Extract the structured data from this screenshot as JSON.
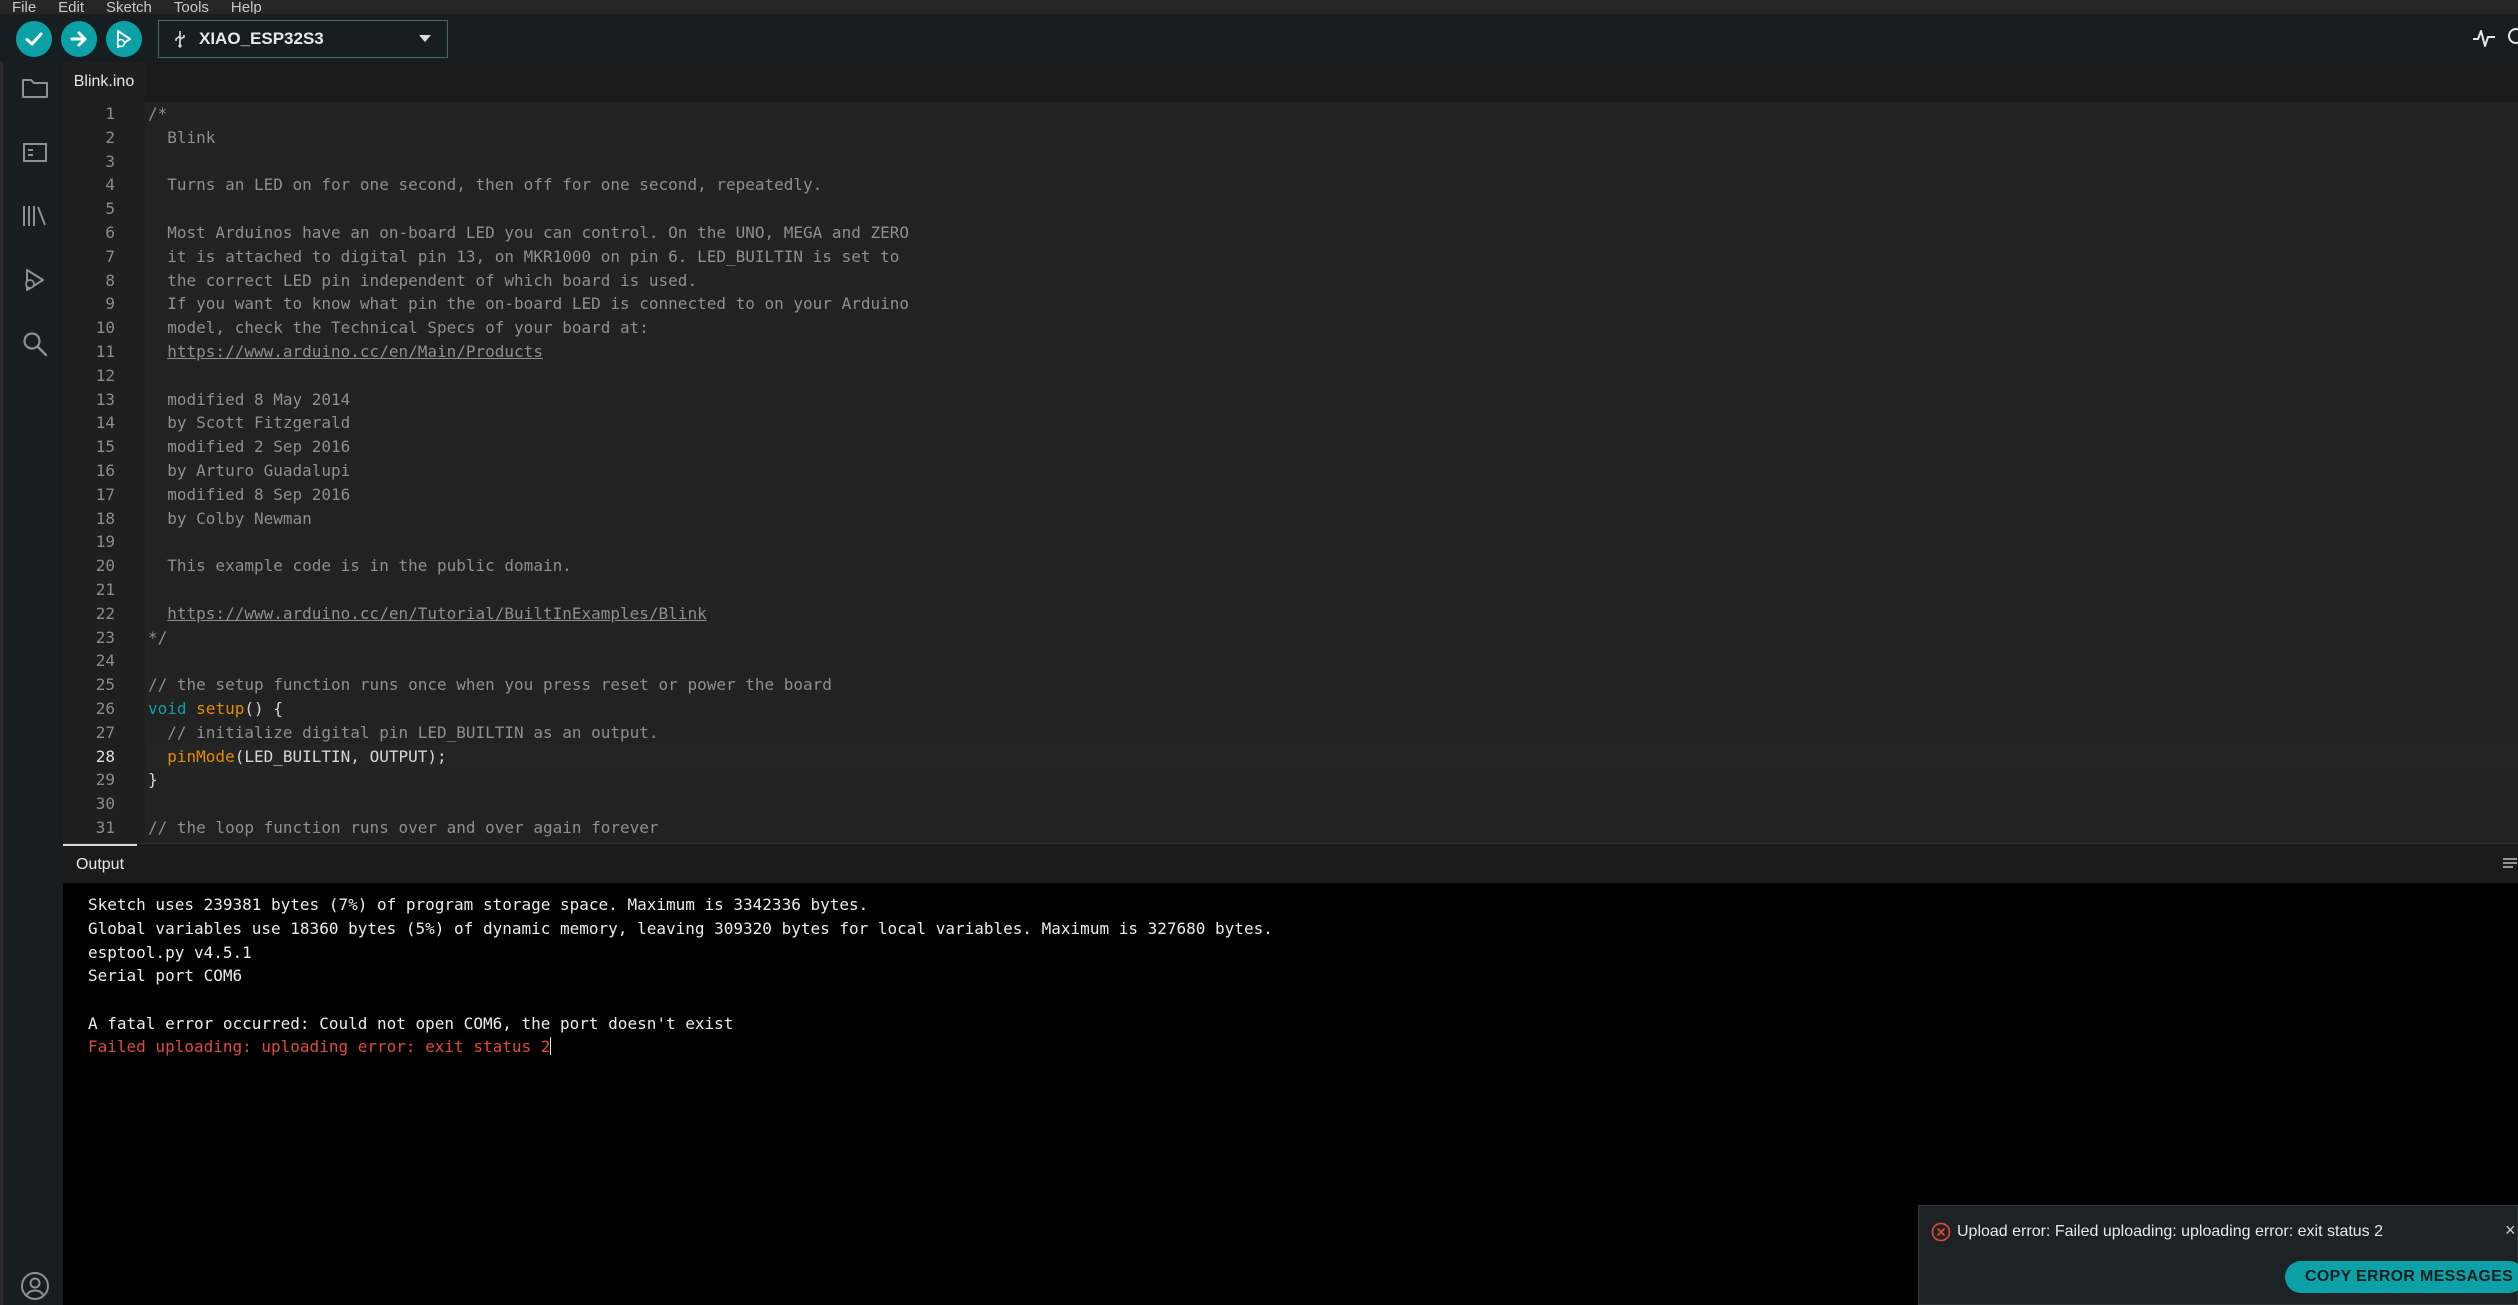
{
  "menu": [
    "File",
    "Edit",
    "Sketch",
    "Tools",
    "Help"
  ],
  "toolbar": {
    "board": "XIAO_ESP32S3",
    "accent": "#0ca1a6"
  },
  "tab": {
    "label": "Blink.ino"
  },
  "editor": {
    "active_line": 28,
    "line_numbers": [
      "1",
      "2",
      "3",
      "4",
      "5",
      "6",
      "7",
      "8",
      "9",
      "10",
      "11",
      "12",
      "13",
      "14",
      "15",
      "16",
      "17",
      "18",
      "19",
      "20",
      "21",
      "22",
      "23",
      "24",
      "25",
      "26",
      "27",
      "28",
      "29",
      "30",
      "31"
    ],
    "lines": [
      "/*",
      "  Blink",
      "",
      "  Turns an LED on for one second, then off for one second, repeatedly.",
      "",
      "  Most Arduinos have an on-board LED you can control. On the UNO, MEGA and ZERO",
      "  it is attached to digital pin 13, on MKR1000 on pin 6. LED_BUILTIN is set to",
      "  the correct LED pin independent of which board is used.",
      "  If you want to know what pin the on-board LED is connected to on your Arduino",
      "  model, check the Technical Specs of your board at:",
      "  https://www.arduino.cc/en/Main/Products",
      "",
      "  modified 8 May 2014",
      "  by Scott Fitzgerald",
      "  modified 2 Sep 2016",
      "  by Arturo Guadalupi",
      "  modified 8 Sep 2016",
      "  by Colby Newman",
      "",
      "  This example code is in the public domain.",
      "",
      "  https://www.arduino.cc/en/Tutorial/BuiltInExamples/Blink",
      "*/",
      "",
      "// the setup function runs once when you press reset or power the board",
      "",
      "  // initialize digital pin LED_BUILTIN as an output.",
      "",
      "}",
      "",
      "// the loop function runs over and over again forever"
    ],
    "l11_link": "https://www.arduino.cc/en/Main/Products",
    "l22_link": "https://www.arduino.cc/en/Tutorial/BuiltInExamples/Blink",
    "l26": {
      "kw": "void",
      "fn": "setup",
      "rest": "() {"
    },
    "l28": {
      "fn": "pinMode",
      "rest": "(LED_BUILTIN, OUTPUT);"
    }
  },
  "output": {
    "tab": "Output",
    "lines": [
      "Sketch uses 239381 bytes (7%) of program storage space. Maximum is 3342336 bytes.",
      "Global variables use 18360 bytes (5%) of dynamic memory, leaving 309320 bytes for local variables. Maximum is 327680 bytes.",
      "esptool.py v4.5.1",
      "Serial port COM6",
      "",
      "A fatal error occurred: Could not open COM6, the port doesn't exist"
    ],
    "error_line": "Failed uploading: uploading error: exit status 2",
    "error_color": "#e14b3b"
  },
  "notification": {
    "message": "Upload error: Failed uploading: uploading error: exit status 2",
    "button": "COPY ERROR MESSAGES",
    "close": "×"
  }
}
